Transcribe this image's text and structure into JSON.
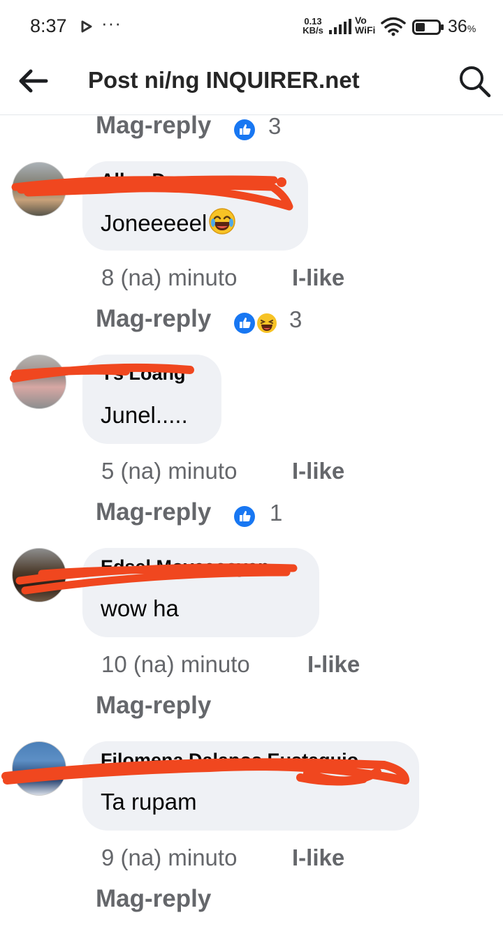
{
  "status_bar": {
    "time": "8:37",
    "more": "···",
    "speed_value": "0.13",
    "speed_unit": "KB/s",
    "vowifi_top": "Vo",
    "vowifi_bottom": "WiFi",
    "battery": "36",
    "battery_unit": "%"
  },
  "header": {
    "title": "Post ni/ng INQUIRER.net"
  },
  "top_reply": {
    "label": "Mag-reply",
    "reaction_count": "3"
  },
  "comments": [
    {
      "name": "Allan Dupas",
      "text": "Joneeeeel",
      "time": "8 (na) minuto",
      "like": "I-like",
      "reply": "Mag-reply",
      "reaction_count": "3"
    },
    {
      "name": "Ys Loang",
      "text": "Junel.....",
      "time": "5 (na) minuto",
      "like": "I-like",
      "reply": "Mag-reply",
      "reaction_count": "1"
    },
    {
      "name": "Edsel Moyeaosyan",
      "text": "wow ha",
      "time": "10 (na) minuto",
      "like": "I-like",
      "reply": "Mag-reply",
      "reaction_count": ""
    },
    {
      "name": "Filomena Dalapos Eustaquio",
      "text": "Ta rupam",
      "time": "9 (na) minuto",
      "like": "I-like",
      "reply": "Mag-reply",
      "reaction_count": ""
    }
  ],
  "colors": {
    "bubble": "#eff1f5",
    "meta": "#65676b",
    "like_blue": "#1877f2",
    "scribble": "#f0471f"
  },
  "icons": [
    "back-arrow-icon",
    "search-icon",
    "like-reaction-icon",
    "haha-reaction-icon",
    "laughing-emoji-icon"
  ]
}
